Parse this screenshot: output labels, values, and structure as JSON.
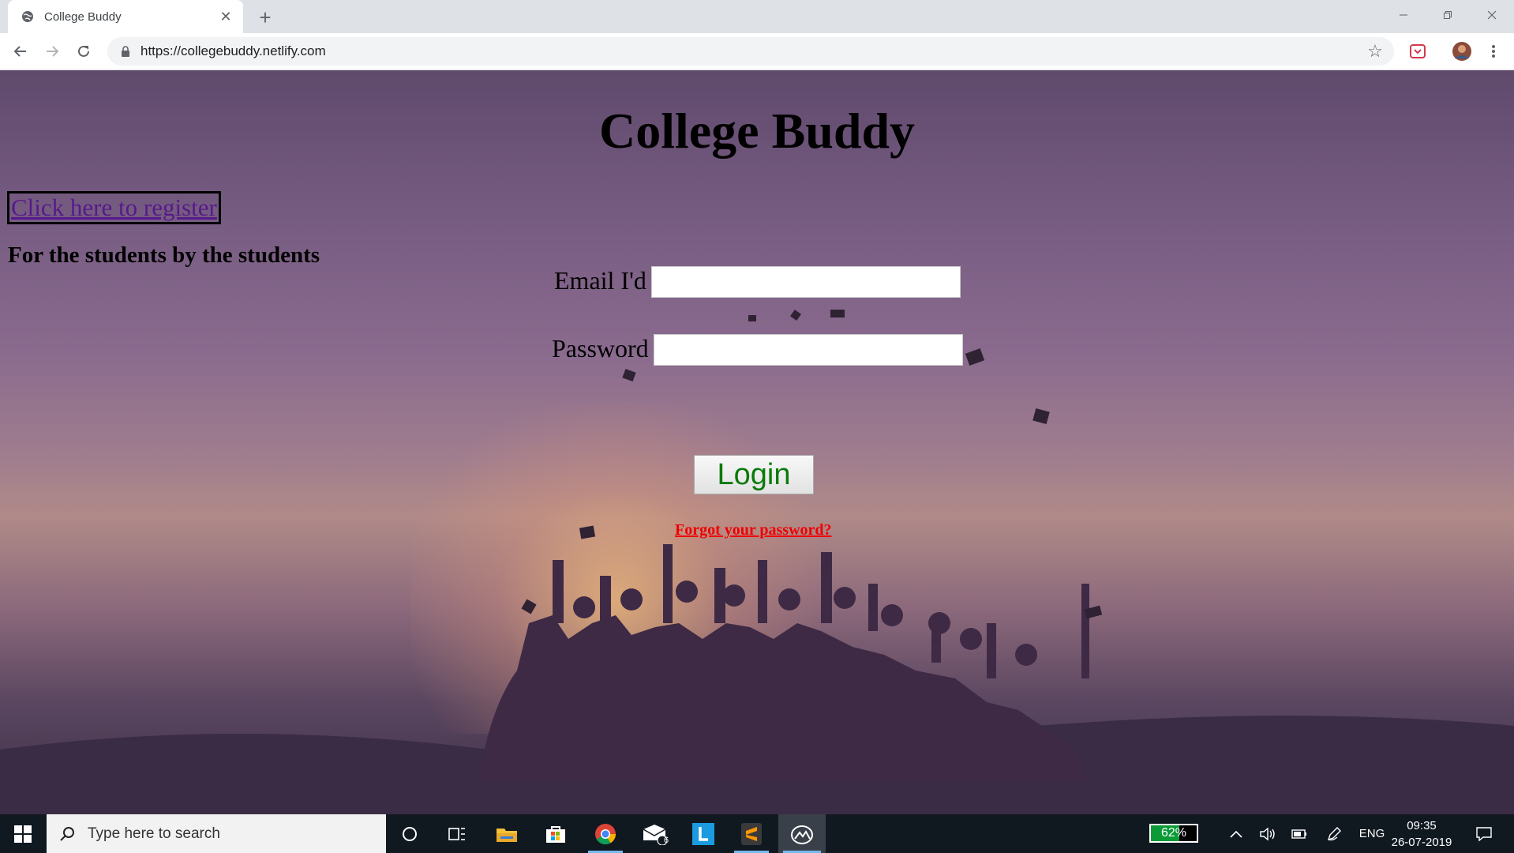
{
  "browser": {
    "tab_title": "College Buddy",
    "tab_close": "✕",
    "new_tab": "+",
    "url": "https://collegebuddy.netlify.com"
  },
  "page": {
    "title": "College Buddy",
    "register_link": "Click here to register",
    "tagline": "For the students by the students",
    "email_label": "Email I'd",
    "email_value": "",
    "password_label": "Password",
    "password_value": "",
    "login_button": "Login",
    "forgot_link": "Forgot your password?"
  },
  "taskbar": {
    "search_placeholder": "Type here to search",
    "mail_badge": "6",
    "battery": "62%",
    "language": "ENG",
    "time": "09:35",
    "date": "26-07-2019"
  },
  "colors": {
    "register_link": "#551a8b",
    "login_text": "#0a7a0a",
    "forgot_link": "#e00000"
  }
}
